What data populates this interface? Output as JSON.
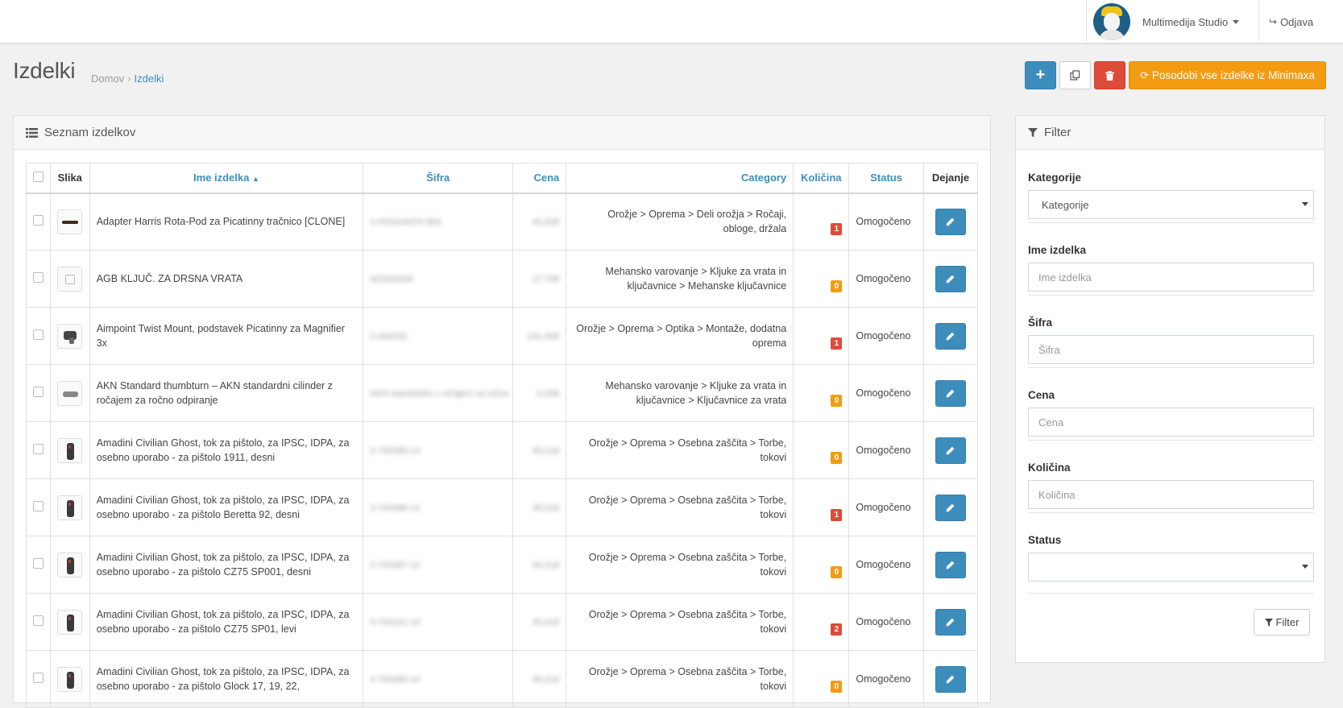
{
  "header": {
    "user_name": "Multimedija Studio",
    "logout_label": "Odjava"
  },
  "page": {
    "title": "Izdelki",
    "breadcrumb": [
      "Domov",
      "Izdelki"
    ],
    "sync_label": "Posodobi vse izdelke iz Minimaxa"
  },
  "list": {
    "title": "Seznam izdelkov",
    "columns": [
      "Slika",
      "Ime izdelka",
      "Šifra",
      "Cena",
      "Category",
      "Količina",
      "Status",
      "Dejanje"
    ],
    "rows": [
      {
        "name": "Adapter Harris Rota-Pod za Picatinny tračnico [CLONE]",
        "code": "1-HOSAAVOI-804",
        "price": "45,008",
        "category": "Orožje  >  Oprema  >  Deli orožja  >  Ročaji, obloge, držala",
        "qty": "1",
        "qty_color": "red",
        "status": "Omogočeno"
      },
      {
        "name": "AGB KLJUČ. ZA DRSNA VRATA",
        "code": "W2300009",
        "price": "27,798",
        "category": "Mehansko varovanje  >  Kljuke za vrata in ključavnice  >  Mehanske ključavnice",
        "qty": "0",
        "qty_color": "orange",
        "status": "Omogočeno"
      },
      {
        "name": "Aimpoint Twist Mount, podstavek Picatinny za Magnifier 3x",
        "code": "2-400031",
        "price": "241,008",
        "category": "Orožje  >  Oprema  >  Optika  >  Montaže, dodatna oprema",
        "qty": "1",
        "qty_color": "red",
        "status": "Omogočeno"
      },
      {
        "name": "AKN Standard thumbturn – AKN standardni cilinder z ročajem za ročno odpiranje",
        "code": "AKN standardni c ročajem za ročno",
        "price": "0,008",
        "category": "Mehansko varovanje  >  Kljuke za vrata in ključavnice  >  Ključavnice za vrata",
        "qty": "0",
        "qty_color": "orange",
        "status": "Omogočeno"
      },
      {
        "name": "Amadini Civilian Ghost, tok za pištolo, za IPSC, IDPA, za osebno uporabo - za pištolo 1911, desni",
        "code": "3-700085-14",
        "price": "45,018",
        "category": "Orožje  >  Oprema  >  Osebna zaščita  >  Torbe, tokovi",
        "qty": "0",
        "qty_color": "orange",
        "status": "Omogočeno"
      },
      {
        "name": "Amadini Civilian Ghost, tok za pištolo, za IPSC, IDPA, za osebno uporabo - za pištolo Beretta 92, desni",
        "code": "3-700086-14",
        "price": "45,018",
        "category": "Orožje  >  Oprema  >  Osebna zaščita  >  Torbe, tokovi",
        "qty": "1",
        "qty_color": "red",
        "status": "Omogočeno"
      },
      {
        "name": "Amadini Civilian Ghost, tok za pištolo, za IPSC, IDPA, za osebno uporabo - za pištolo CZ75 SP001, desni",
        "code": "3-700087-14",
        "price": "45,018",
        "category": "Orožje  >  Oprema  >  Osebna zaščita  >  Torbe, tokovi",
        "qty": "0",
        "qty_color": "orange",
        "status": "Omogočeno"
      },
      {
        "name": "Amadini Civilian Ghost, tok za pištolo, za IPSC, IDPA, za osebno uporabo - za pištolo CZ75 SP01, levi",
        "code": "3-700191-14",
        "price": "45,018",
        "category": "Orožje  >  Oprema  >  Osebna zaščita  >  Torbe, tokovi",
        "qty": "2",
        "qty_color": "red",
        "status": "Omogočeno"
      },
      {
        "name": "Amadini Civilian Ghost, tok za pištolo, za IPSC, IDPA, za osebno uporabo - za pištolo Glock 17, 19, 22,",
        "code": "3-700089-14",
        "price": "45,018",
        "category": "Orožje  >  Oprema  >  Osebna zaščita  >  Torbe, tokovi",
        "qty": "0",
        "qty_color": "orange",
        "status": "Omogočeno"
      }
    ]
  },
  "filter": {
    "title": "Filter",
    "category_label": "Kategorije",
    "category_value": "Kategorije",
    "name_label": "Ime izdelka",
    "name_placeholder": "Ime izdelka",
    "code_label": "Šifra",
    "code_placeholder": "Šifra",
    "price_label": "Cena",
    "price_placeholder": "Cena",
    "qty_label": "Količina",
    "qty_placeholder": "Količina",
    "status_label": "Status",
    "status_value": "",
    "button_label": "Filter"
  },
  "icons": {
    "add": "plus-icon",
    "copy": "copy-icon",
    "delete": "trash-icon",
    "sync": "refresh-icon",
    "list": "list-icon",
    "filter": "funnel-icon",
    "edit": "pencil-icon",
    "logout": "sign-out-icon"
  },
  "colors": {
    "primary": "#3c8dbc",
    "danger": "#dd4b39",
    "warning": "#f39c12"
  }
}
